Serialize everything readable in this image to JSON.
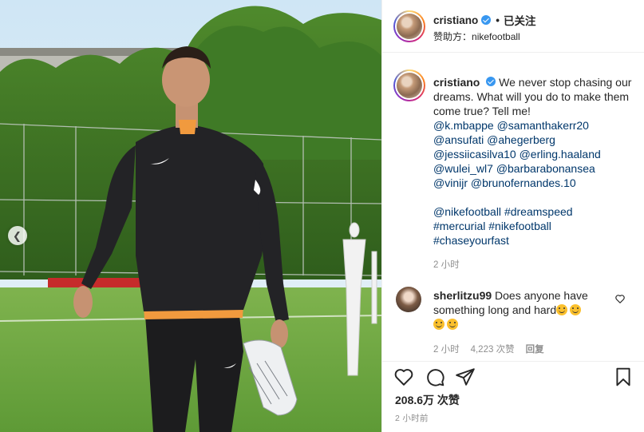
{
  "header": {
    "username": "cristiano",
    "dot": "•",
    "follow_state": "已关注",
    "sponsor_label": "赞助方：",
    "sponsor_name": "nikefootball"
  },
  "caption": {
    "username": "cristiano",
    "text": "We never stop chasing our dreams. What will you do to make them come true? Tell me!",
    "mentions": [
      "@k.mbappe",
      "@samanthakerr20",
      "@ansufati",
      "@ahegerberg",
      "@jessiicasilva10",
      "@erling.haaland",
      "@wulei_wl7",
      "@barbarabonansea",
      "@vinijr",
      "@brunofernandes.10"
    ],
    "hashtags": [
      "@nikefootball",
      "#dreamspeed",
      "#mercurial",
      "#nikefootball",
      "#chaseyourfast"
    ],
    "time": "2 小时"
  },
  "comment": {
    "username": "sherlitzu99",
    "text": "Does anyone have something long and hard",
    "time": "2 小时",
    "likes": "4,223 次赞",
    "reply_label": "回复"
  },
  "footer": {
    "likes": "208.6万 次赞",
    "time": "2 小时前"
  },
  "icons": {
    "like": "heart-icon",
    "comment": "comment-icon",
    "share": "share-icon",
    "save": "bookmark-icon",
    "verified": "verified-badge-icon",
    "carousel_prev": "chevron-left-icon"
  },
  "colors": {
    "verified": "#3897f0",
    "link": "#00376b",
    "muted": "#8e8e8e"
  }
}
